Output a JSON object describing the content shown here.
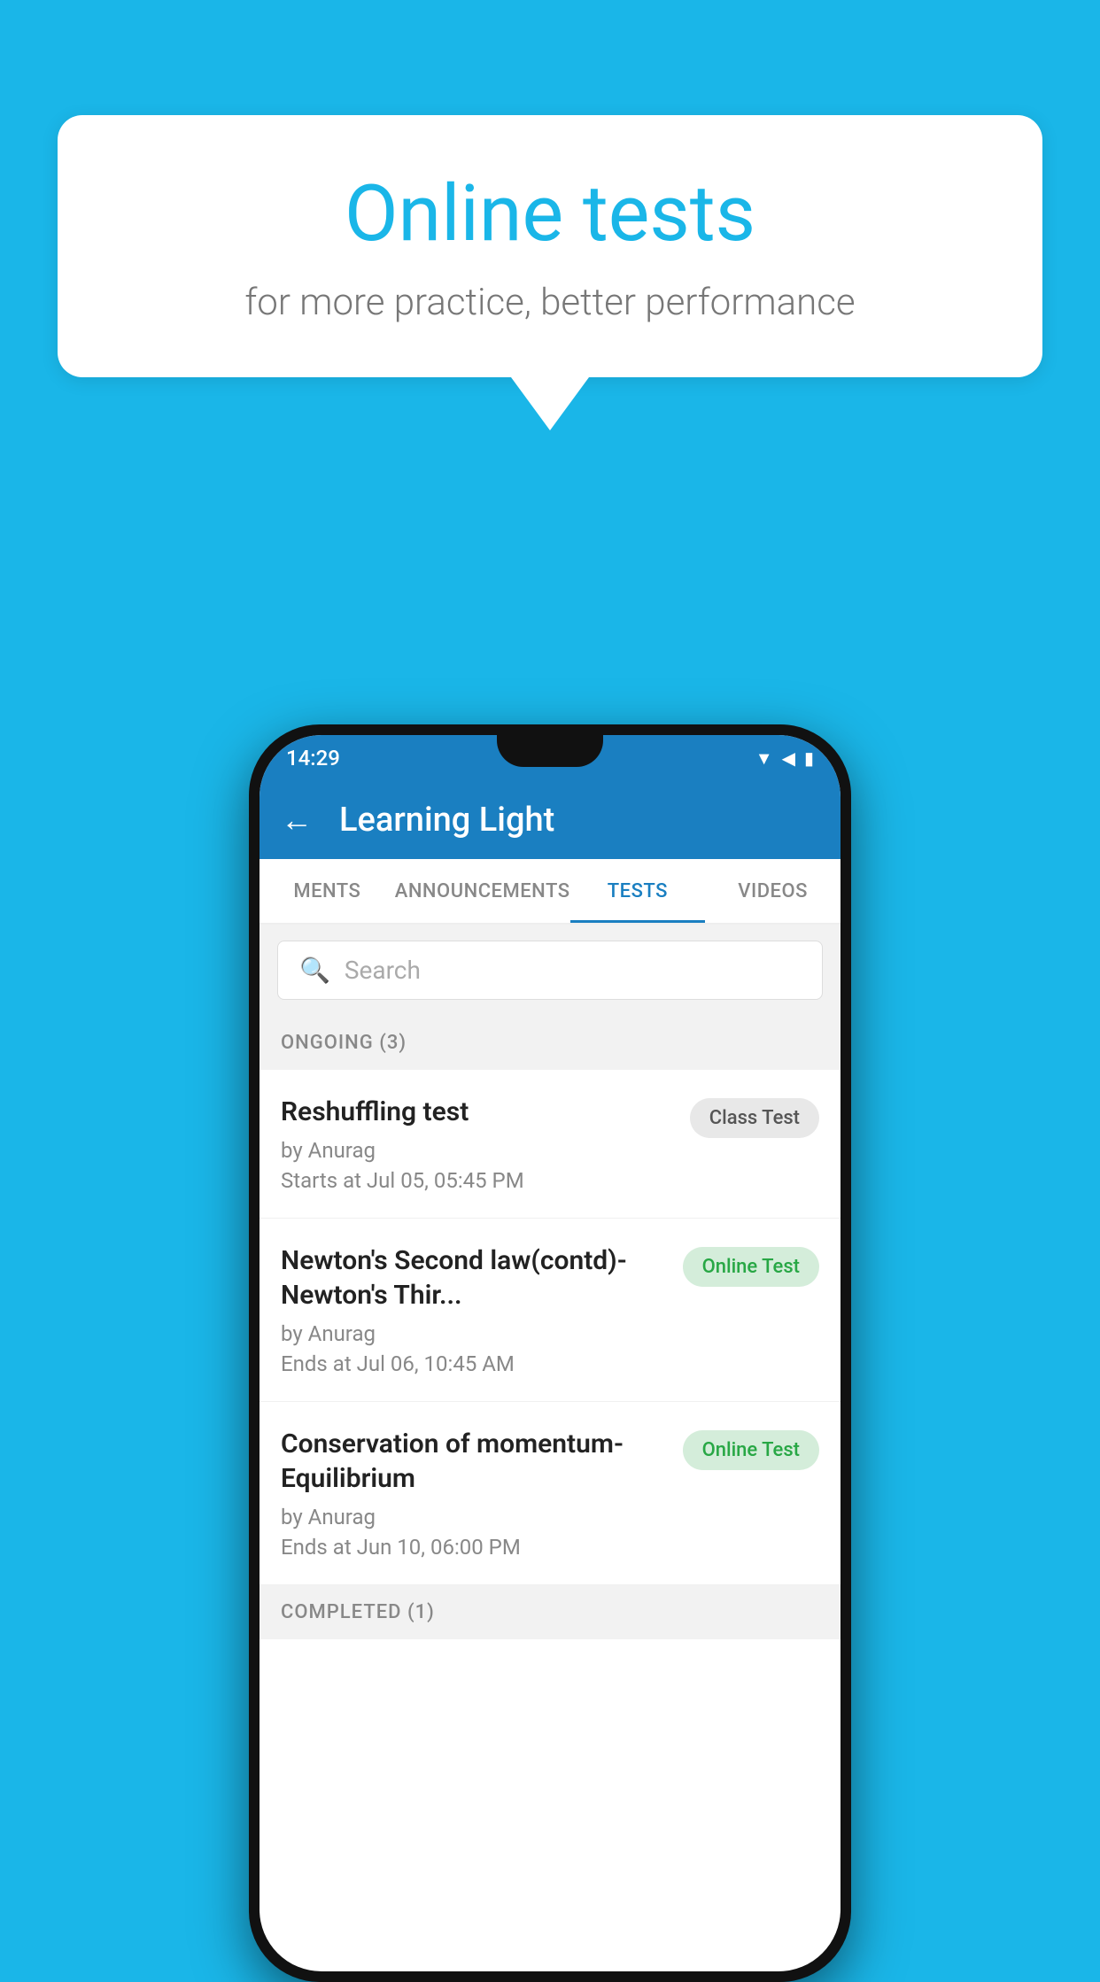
{
  "background_color": "#1ab6e8",
  "bubble": {
    "title": "Online tests",
    "subtitle": "for more practice, better performance"
  },
  "phone": {
    "status_bar": {
      "time": "14:29",
      "icons": "▼◀▮"
    },
    "app_bar": {
      "title": "Learning Light",
      "back_label": "←"
    },
    "tabs": [
      {
        "label": "MENTS",
        "active": false
      },
      {
        "label": "ANNOUNCEMENTS",
        "active": false
      },
      {
        "label": "TESTS",
        "active": true
      },
      {
        "label": "VIDEOS",
        "active": false
      }
    ],
    "search": {
      "placeholder": "Search"
    },
    "ongoing_section": {
      "label": "ONGOING (3)"
    },
    "tests": [
      {
        "name": "Reshuffling test",
        "by": "by Anurag",
        "date": "Starts at  Jul 05, 05:45 PM",
        "badge": "Class Test",
        "badge_type": "class"
      },
      {
        "name": "Newton's Second law(contd)-Newton's Thir...",
        "by": "by Anurag",
        "date": "Ends at  Jul 06, 10:45 AM",
        "badge": "Online Test",
        "badge_type": "online"
      },
      {
        "name": "Conservation of momentum-Equilibrium",
        "by": "by Anurag",
        "date": "Ends at  Jun 10, 06:00 PM",
        "badge": "Online Test",
        "badge_type": "online"
      }
    ],
    "completed_section": {
      "label": "COMPLETED (1)"
    }
  }
}
